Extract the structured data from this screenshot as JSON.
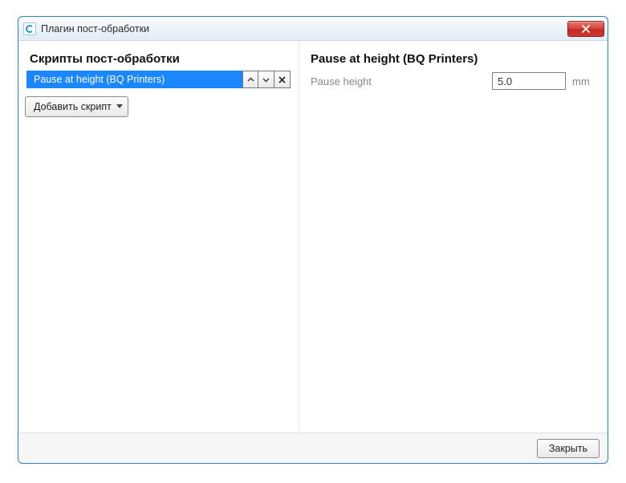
{
  "window": {
    "title": "Плагин пост-обработки"
  },
  "left": {
    "heading": "Скрипты пост-обработки",
    "scripts": [
      {
        "name": "Pause at height (BQ Printers)"
      }
    ],
    "add_label": "Добавить скрипт"
  },
  "right": {
    "heading": "Pause at height (BQ Printers)",
    "fields": [
      {
        "label": "Pause height",
        "value": "5.0",
        "unit": "mm"
      }
    ]
  },
  "footer": {
    "close_label": "Закрыть"
  }
}
